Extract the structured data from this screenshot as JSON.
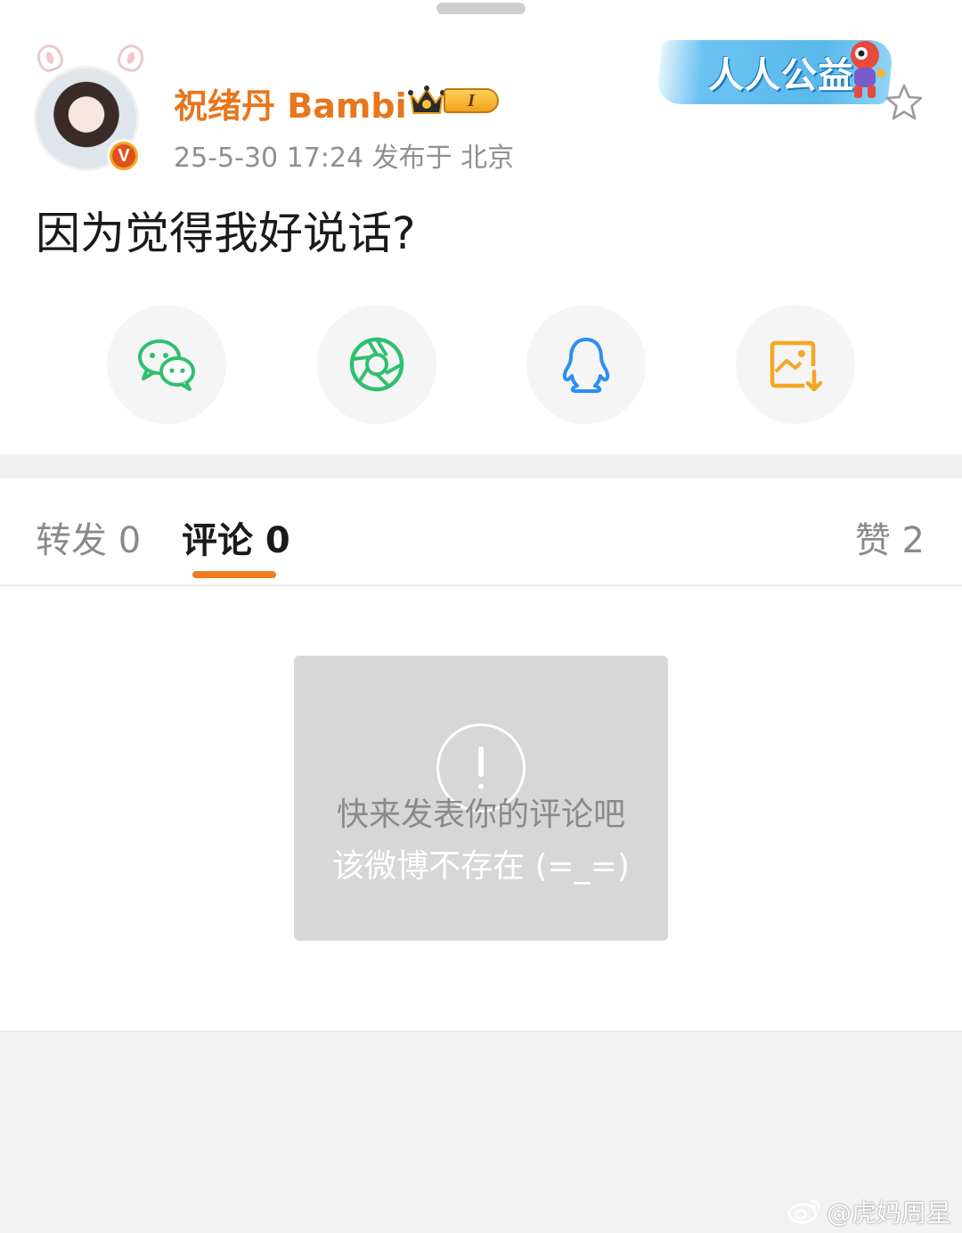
{
  "author": {
    "name": "祝绪丹 Bambi",
    "level": "I",
    "verified_mark": "V",
    "meta": "25-5-30 17:24  发布于 北京"
  },
  "banner": {
    "text": "人人公益"
  },
  "post": {
    "text": "因为觉得我好说话?"
  },
  "share": [
    {
      "icon": "wechat-icon",
      "color": "#2fbf71"
    },
    {
      "icon": "moments-icon",
      "color": "#2fbf71"
    },
    {
      "icon": "qq-icon",
      "color": "#2a8ef5"
    },
    {
      "icon": "save-image-icon",
      "color": "#f5a623"
    }
  ],
  "tabs": {
    "repost": "转发 0",
    "comment": "评论 0",
    "like": "赞 2",
    "active": "comment",
    "accent": "#f07b22"
  },
  "empty_state": {
    "hint": "快来发表你的评论吧",
    "toast": "该微博不存在 (=_=)"
  },
  "watermark": {
    "text": "@虎妈周星"
  },
  "colors": {
    "username": "#e8761c",
    "meta": "#8f8f8f"
  }
}
